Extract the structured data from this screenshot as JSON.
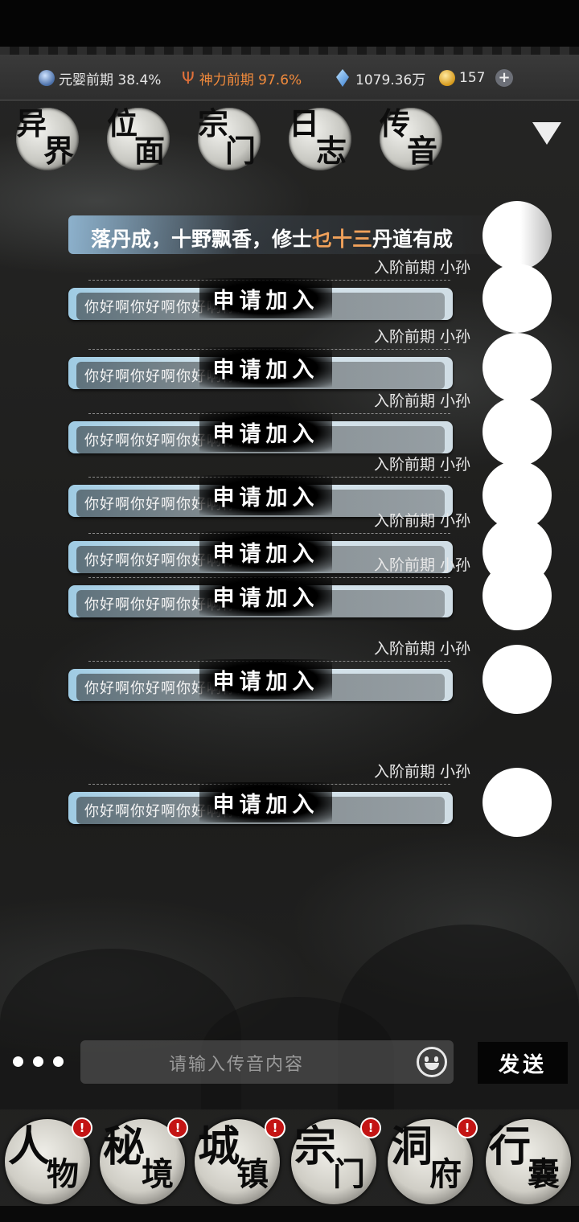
{
  "resources": {
    "realm": "元婴前期 38.4%",
    "divine_power": "神力前期 97.6%",
    "spirit_stones": "1079.36万",
    "gold": "157"
  },
  "colors": {
    "divine_power": "#f08a3c",
    "announce_highlight": "#f0a15a",
    "badge": "#c41414"
  },
  "nav_tabs": [
    {
      "c1": "异",
      "c2": "界"
    },
    {
      "c1": "位",
      "c2": "面"
    },
    {
      "c1": "宗",
      "c2": "门"
    },
    {
      "c1": "日",
      "c2": "志"
    },
    {
      "c1": "传",
      "c2": "音"
    }
  ],
  "announcement": {
    "prefix": "落丹成，十野飘香，修士",
    "highlight": "乜十三",
    "suffix": "丹道有成"
  },
  "messages": [
    {
      "meta": "入阶前期 小孙",
      "text": "你好啊你好啊你好啊你好啊你好",
      "action": "申请加入"
    },
    {
      "meta": "入阶前期 小孙",
      "text": "你好啊你好啊你好啊你好啊你好",
      "action": "申请加入"
    },
    {
      "meta": "入阶前期 小孙",
      "text": "你好啊你好啊你好啊你好啊你好",
      "action": "申请加入"
    },
    {
      "meta": "入阶前期 小孙",
      "text": "你好啊你好啊你好啊你好啊你好",
      "action": "申请加入"
    },
    {
      "meta": "入阶前期 小孙",
      "text": "你好啊你好啊你好啊你好啊你好",
      "action": "申请加入"
    },
    {
      "meta": "入阶前期 小孙",
      "text": "你好啊你好啊你好啊你好啊你好",
      "action": "申请加入"
    },
    {
      "meta": "入阶前期 小孙",
      "text": "你好啊你好啊你好啊你好啊你好",
      "action": "申请加入"
    },
    {
      "meta": "入阶前期 小孙",
      "text": "你好啊你好啊你好啊你好啊你好",
      "action": "申请加入"
    }
  ],
  "input": {
    "placeholder": "请输入传音内容",
    "send_label": "发送"
  },
  "bottom_nav": [
    {
      "c1": "人",
      "c2": "物",
      "badge": "!"
    },
    {
      "c1": "秘",
      "c2": "境",
      "badge": "!"
    },
    {
      "c1": "城",
      "c2": "镇",
      "badge": "!"
    },
    {
      "c1": "宗",
      "c2": "门",
      "badge": "!"
    },
    {
      "c1": "洞",
      "c2": "府",
      "badge": "!"
    },
    {
      "c1": "行",
      "c2": "囊",
      "badge": ""
    }
  ]
}
